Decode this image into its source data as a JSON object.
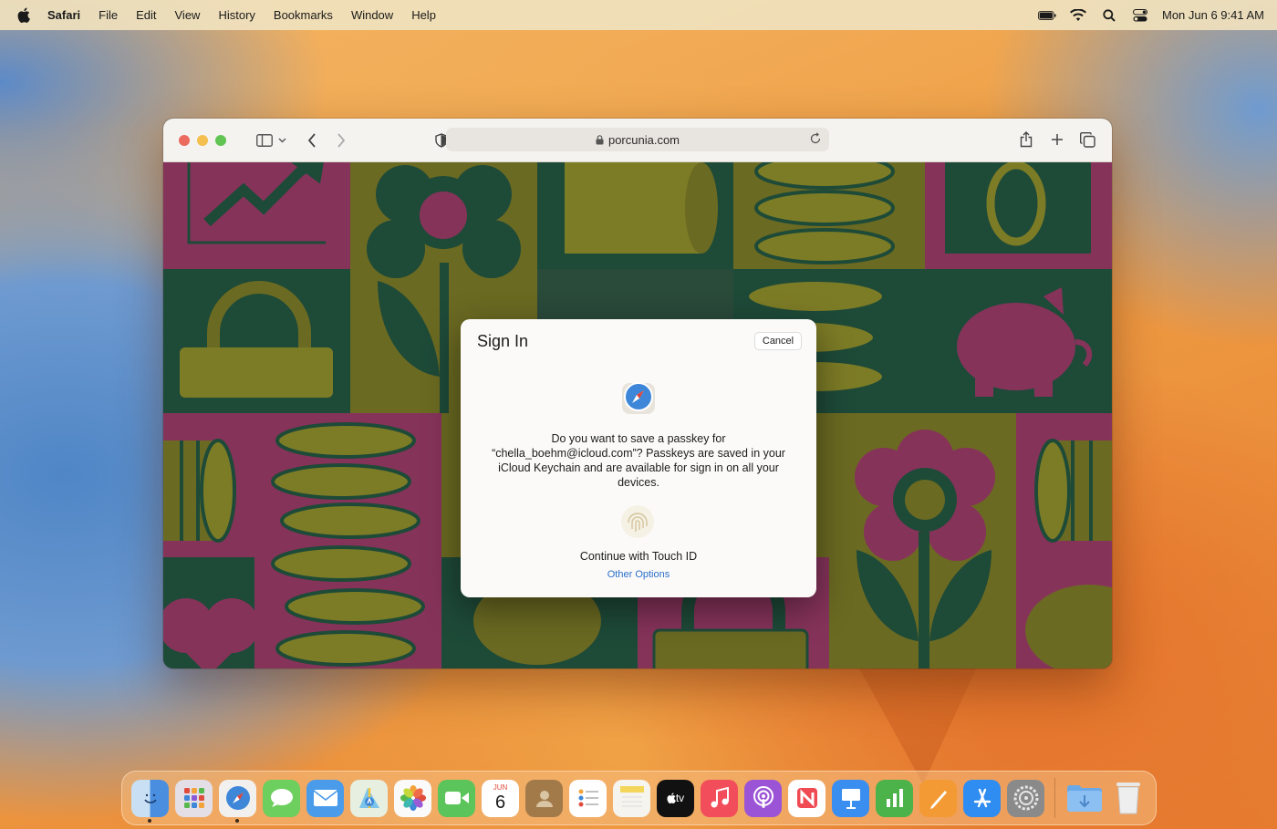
{
  "menubar": {
    "app_name": "Safari",
    "items": [
      "File",
      "Edit",
      "View",
      "History",
      "Bookmarks",
      "Window",
      "Help"
    ],
    "datetime": "Mon Jun 6  9:41 AM"
  },
  "browser": {
    "url": "porcunia.com"
  },
  "dialog": {
    "title": "Sign In",
    "cancel_label": "Cancel",
    "message": "Do you want to save a passkey for “chella_boehm@icloud.com”? Passkeys are saved in your iCloud Keychain and are available for sign in on all your devices.",
    "touch_label": "Continue with Touch ID",
    "other_options_label": "Other Options"
  },
  "dock": {
    "calendar_month": "JUN",
    "calendar_day": "6",
    "tv_label": "tv"
  },
  "colors": {
    "accent": "#2a6fc9",
    "pattern_magenta": "#86335a",
    "pattern_green": "#1e4a38",
    "pattern_olive": "#6b6a22"
  }
}
